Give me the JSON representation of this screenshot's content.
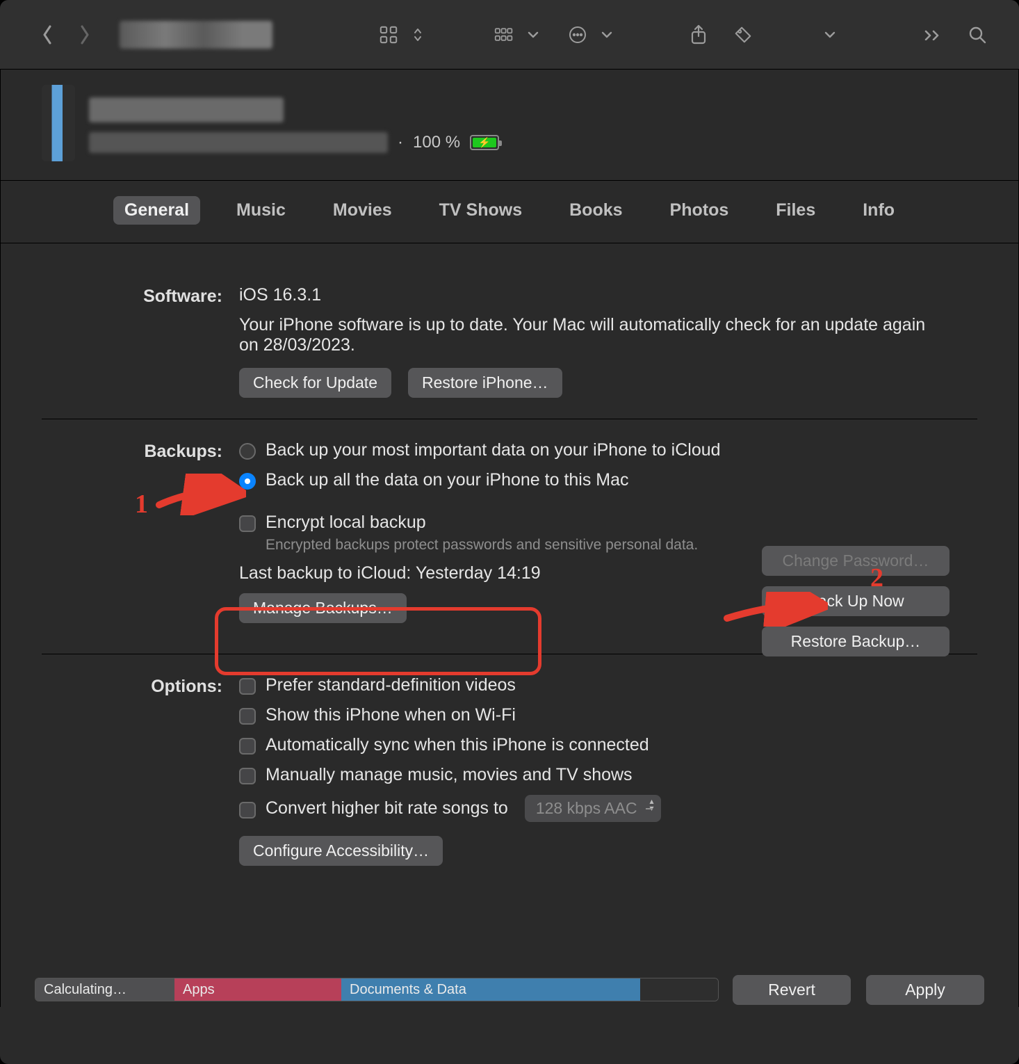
{
  "device": {
    "battery_percent": "100 %"
  },
  "tabs": [
    "General",
    "Music",
    "Movies",
    "TV Shows",
    "Books",
    "Photos",
    "Files",
    "Info"
  ],
  "software": {
    "label": "Software:",
    "version": "iOS 16.3.1",
    "status": "Your iPhone software is up to date. Your Mac will automatically check for an update again on 28/03/2023.",
    "check_btn": "Check for Update",
    "restore_btn": "Restore iPhone…"
  },
  "backups": {
    "label": "Backups:",
    "opt_icloud": "Back up your most important data on your iPhone to iCloud",
    "opt_local": "Back up all the data on your iPhone to this Mac",
    "encrypt_label": "Encrypt local backup",
    "encrypt_hint": "Encrypted backups protect passwords and sensitive personal data.",
    "last_backup": "Last backup to iCloud: Yesterday 14:19",
    "manage_btn": "Manage Backups…",
    "change_pw_btn": "Change Password…",
    "backup_now_btn": "Back Up Now",
    "restore_backup_btn": "Restore Backup…"
  },
  "options": {
    "label": "Options:",
    "sd_videos": "Prefer standard-definition videos",
    "wifi": "Show this iPhone when on Wi-Fi",
    "autosync": "Automatically sync when this iPhone is connected",
    "manual": "Manually manage music, movies and TV shows",
    "convert": "Convert higher bit rate songs to",
    "bitrate": "128 kbps AAC",
    "configure_a11y": "Configure Accessibility…"
  },
  "storage": {
    "calc": "Calculating…",
    "apps": "Apps",
    "docs": "Documents & Data"
  },
  "footer": {
    "revert": "Revert",
    "apply": "Apply"
  },
  "annotations": {
    "one": "1",
    "two": "2"
  }
}
